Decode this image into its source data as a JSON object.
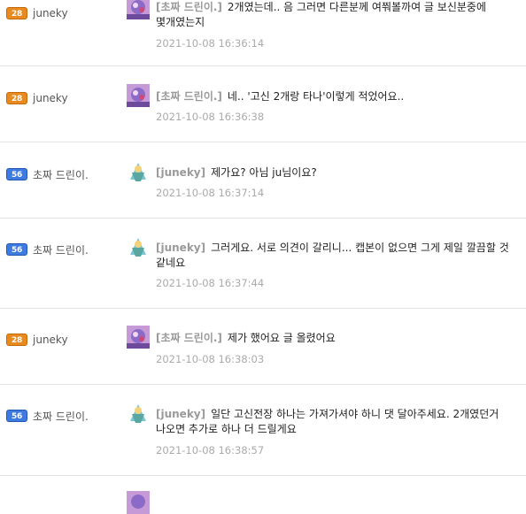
{
  "comments": [
    {
      "author_level": "28",
      "author": "juneky",
      "reply_to": "[초짜 드린이.]",
      "text": "2개였는데.. 음 그러면 다른분께 여쭤볼까여 글 보신분중에 몇개였는지",
      "time": "2021-10-08 16:36:14"
    },
    {
      "author_level": "28",
      "author": "juneky",
      "reply_to": "[초짜 드린이.]",
      "text": "네.. '고신 2개랑 타나'이렇게 적었어요..",
      "time": "2021-10-08 16:36:38"
    },
    {
      "author_level": "56",
      "author": "초짜 드린이.",
      "reply_to": "[juneky]",
      "text": "제가요? 아님 ju님이요?",
      "time": "2021-10-08 16:37:14"
    },
    {
      "author_level": "56",
      "author": "초짜 드린이.",
      "reply_to": "[juneky]",
      "text": "그러게요. 서로 의견이 갈리니... 캡본이 없으면 그게 제일 깔끔할 것 같네요",
      "time": "2021-10-08 16:37:44"
    },
    {
      "author_level": "28",
      "author": "juneky",
      "reply_to": "[초짜 드린이.]",
      "text": "제가 했어요 글 올렸어요",
      "time": "2021-10-08 16:38:03"
    },
    {
      "author_level": "56",
      "author": "초짜 드린이.",
      "reply_to": "[juneky]",
      "text": "일단 고신전장 하나는 가져가셔야 하니 댓 달아주세요. 2개였던거 나오면 추가로 하나 더 드릴게요",
      "time": "2021-10-08 16:38:57"
    }
  ],
  "colors": {
    "level_28": "#e88a1e",
    "level_56": "#3d7be0",
    "reply": "#9a9a9a",
    "time": "#aaaaaa",
    "divider": "#e3e3e3"
  }
}
